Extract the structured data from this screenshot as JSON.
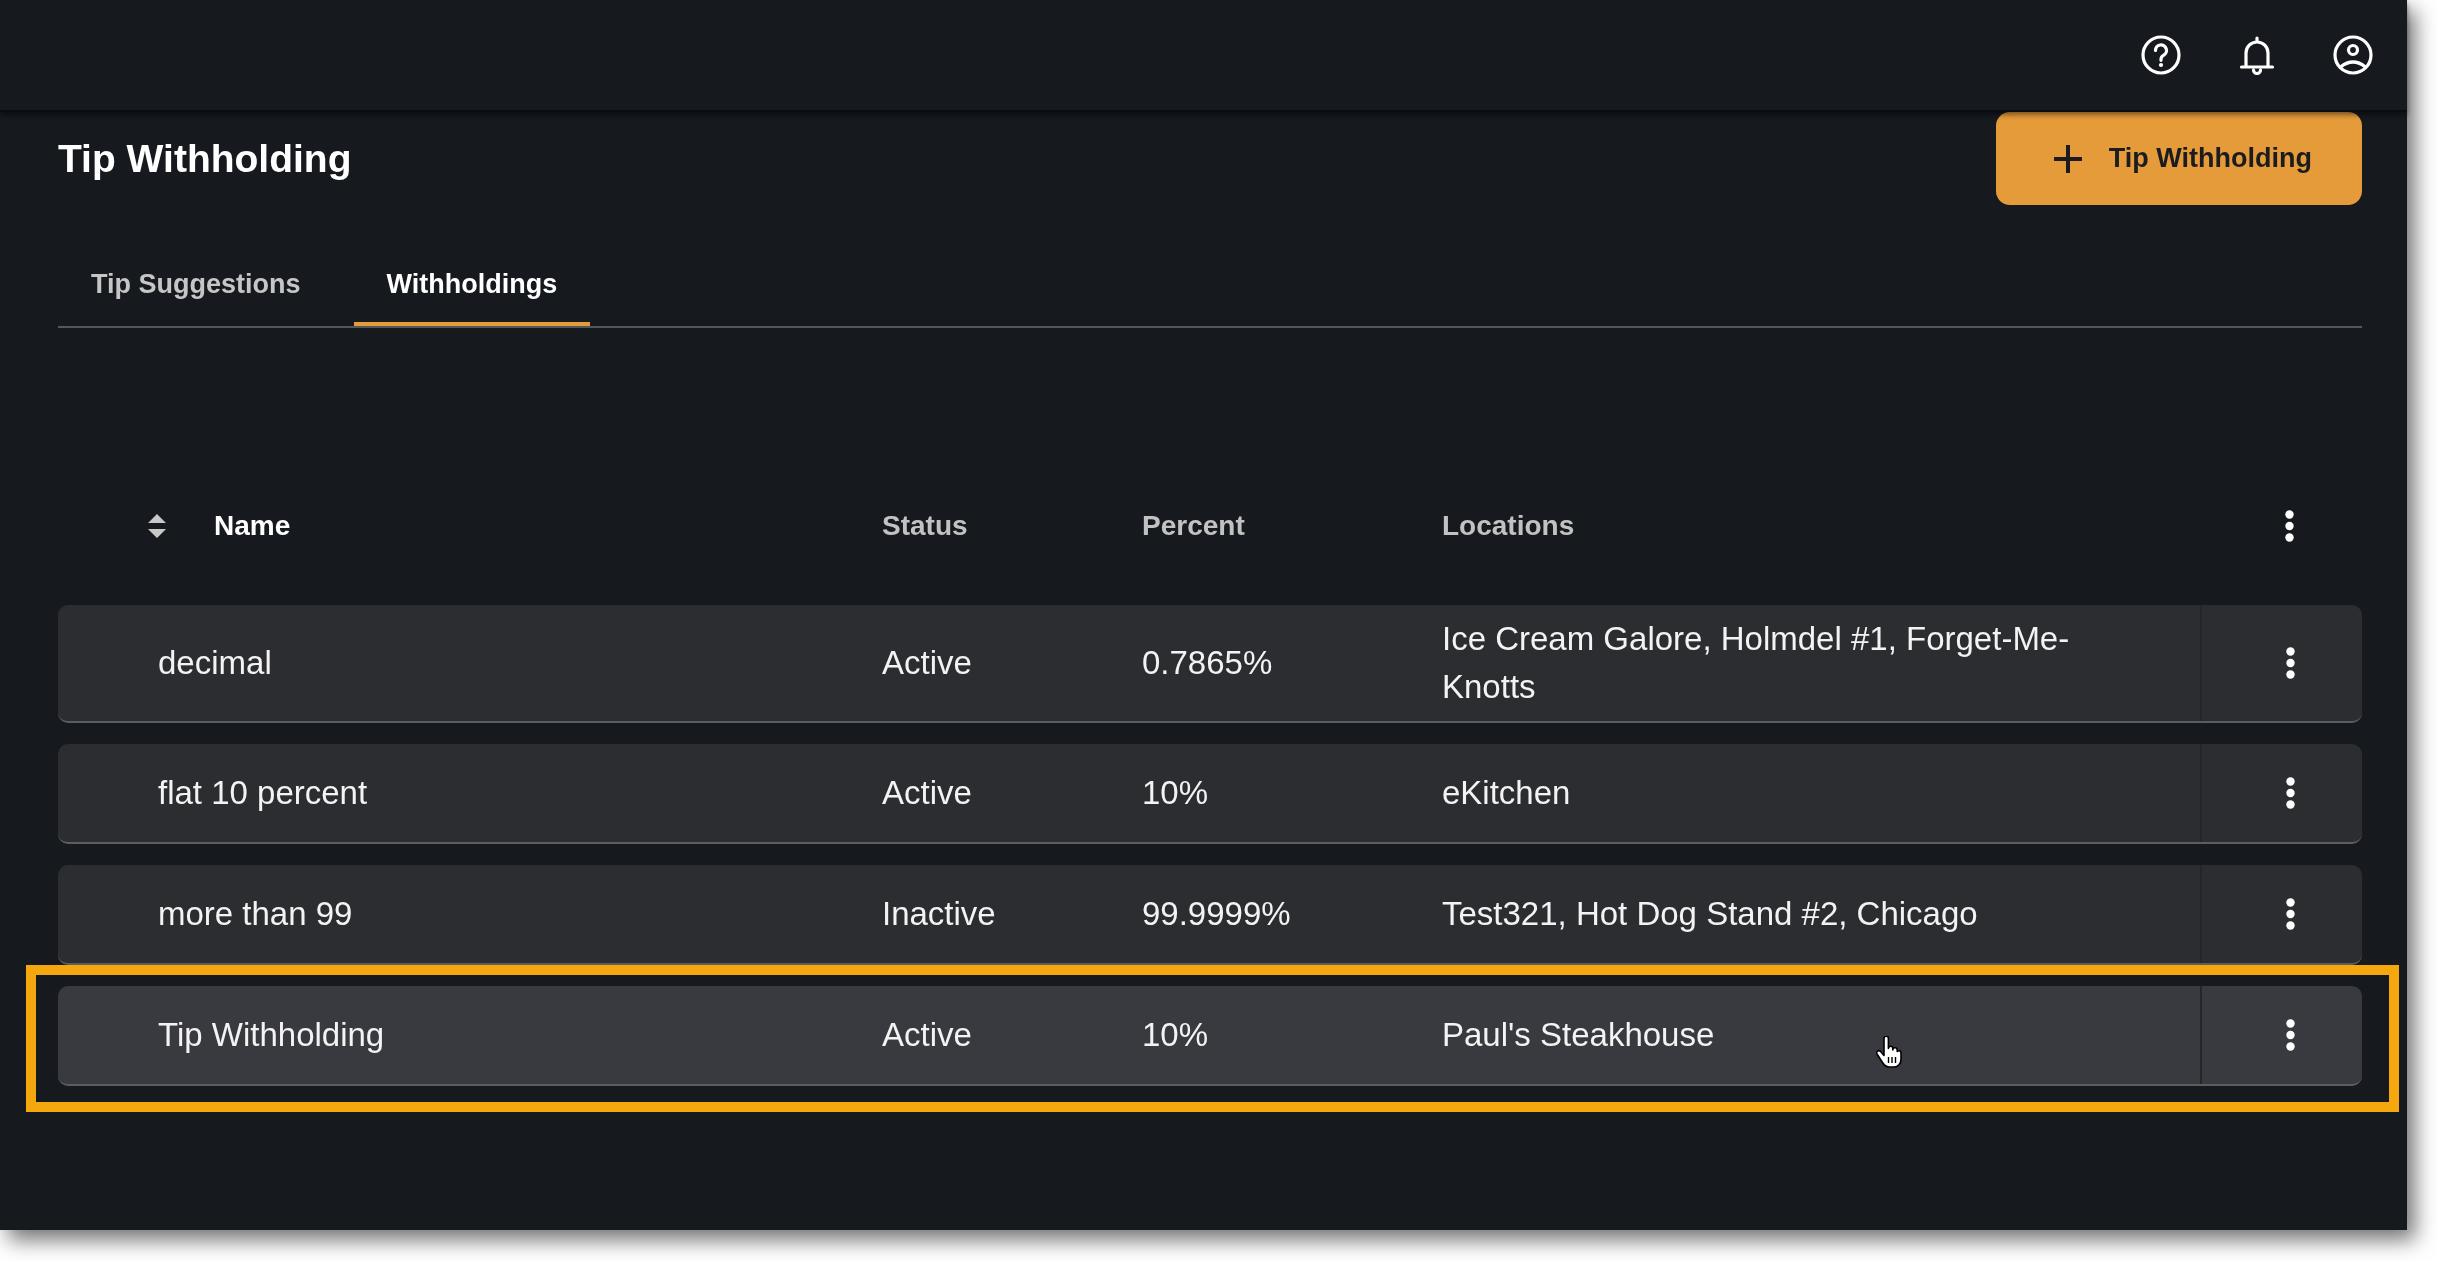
{
  "page": {
    "title": "Tip Withholding"
  },
  "add_button": {
    "label": "Tip Withholding"
  },
  "tabs": [
    {
      "label": "Tip Suggestions",
      "selected": false
    },
    {
      "label": "Withholdings",
      "selected": true
    }
  ],
  "table": {
    "columns": [
      {
        "label": "Name",
        "sortable": true
      },
      {
        "label": "Status",
        "sortable": false
      },
      {
        "label": "Percent",
        "sortable": false
      },
      {
        "label": "Locations",
        "sortable": false
      }
    ],
    "rows": [
      {
        "name": "decimal",
        "status": "Active",
        "percent": "0.7865%",
        "locations": "Ice Cream Galore, Holmdel #1, Forget-Me-Knotts",
        "highlighted": false
      },
      {
        "name": "flat 10 percent",
        "status": "Active",
        "percent": "10%",
        "locations": "eKitchen",
        "highlighted": false
      },
      {
        "name": "more than 99",
        "status": "Inactive",
        "percent": "99.9999%",
        "locations": "Test321, Hot Dog Stand #2, Chicago",
        "highlighted": false
      },
      {
        "name": "Tip Withholding",
        "status": "Active",
        "percent": "10%",
        "locations": "Paul's Steakhouse",
        "highlighted": true
      }
    ]
  }
}
